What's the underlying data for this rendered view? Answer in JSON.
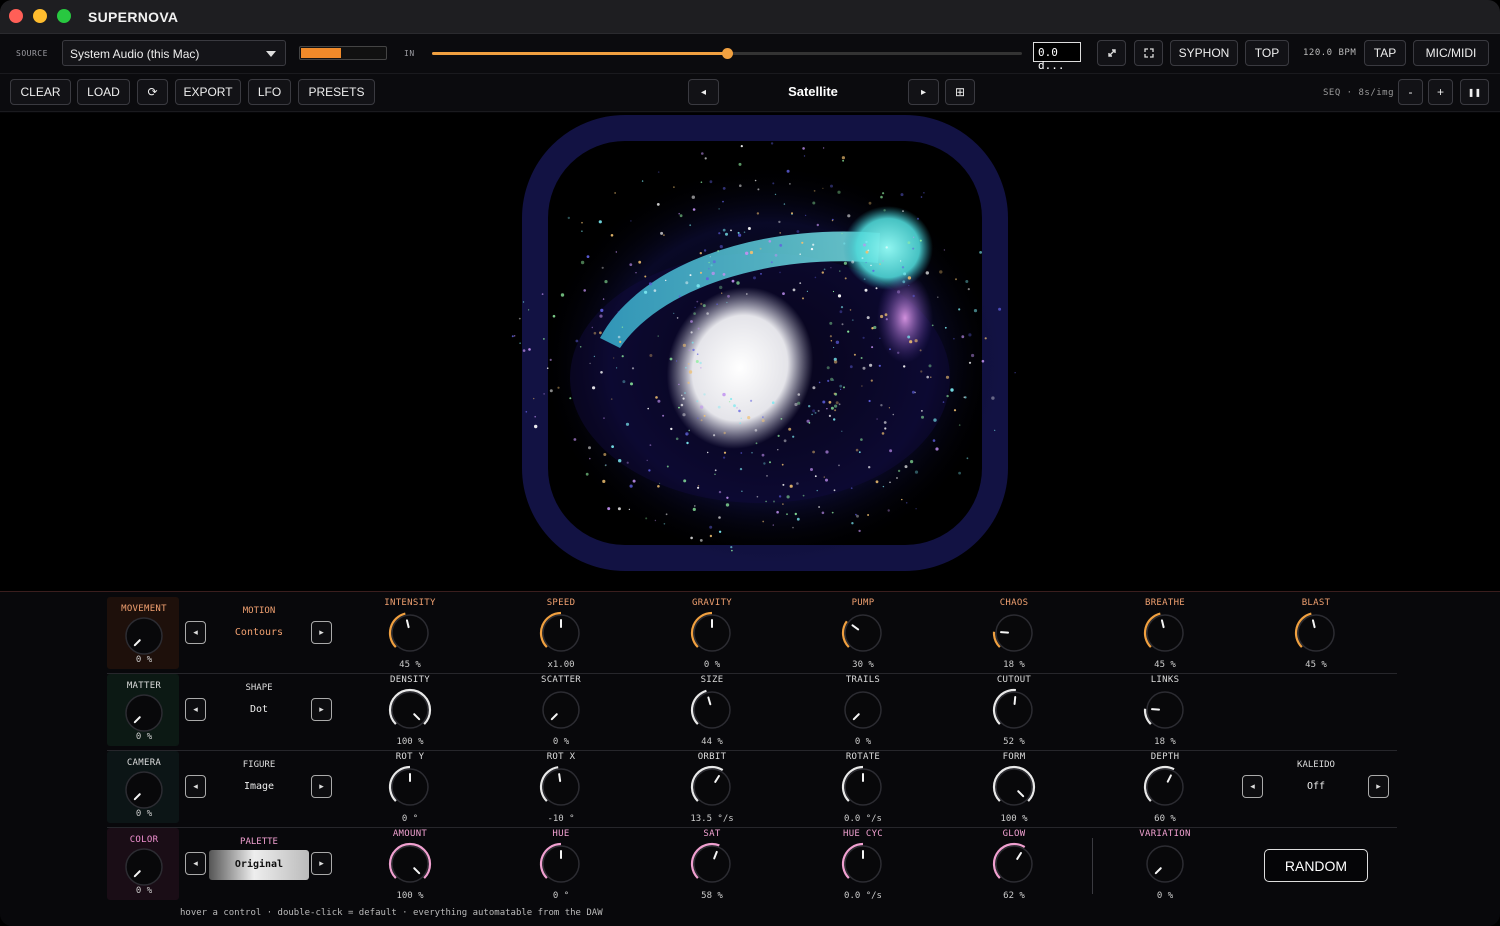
{
  "window": {
    "title": "SUPERNOVA"
  },
  "toolbar1": {
    "source_label": "SOURCE",
    "source_value": "System Audio (this Mac)",
    "level": 0.47,
    "in_label": "IN",
    "in_gain": 0.5,
    "readout": "0.0 d...",
    "minimize_icon": "diagonal-arrows-icon",
    "fullscreen_icon": "fullscreen-corners-icon",
    "syphon": "SYPHON",
    "top": "TOP",
    "bpm": "120.0 BPM",
    "tap": "TAP",
    "micmidi": "MIC/MIDI"
  },
  "toolbar2": {
    "clear": "CLEAR",
    "load": "LOAD",
    "refresh_glyph": "⟳",
    "export": "EXPORT",
    "lfo": "LFO",
    "presets": "PRESETS",
    "prev_glyph": "◂",
    "preset_name": "Satellite",
    "next_glyph": "▸",
    "grid_glyph": "⊞",
    "seq": "SEQ · 8s/img",
    "minus": "-",
    "plus": "+",
    "pause_glyph": "❚❚"
  },
  "sections": [
    {
      "name": "MOVEMENT",
      "value": "0 %",
      "color": "#f0a070",
      "bg": "#1e100b",
      "pos": 0.0
    },
    {
      "name": "MATTER",
      "value": "0 %",
      "color": "#dddddd",
      "bg": "#0c1914",
      "pos": 0.0
    },
    {
      "name": "CAMERA",
      "value": "0 %",
      "color": "#dddddd",
      "bg": "#0c1516",
      "pos": 0.0
    },
    {
      "name": "COLOR",
      "value": "0 %",
      "color": "#f090d0",
      "bg": "#1a0d16",
      "pos": 0.0
    }
  ],
  "choosers": [
    {
      "label": "MOTION",
      "value": "Contours",
      "color": "#f0a070"
    },
    {
      "label": "SHAPE",
      "value": "Dot",
      "color": "#dddddd"
    },
    {
      "label": "FIGURE",
      "value": "Image",
      "color": "#dddddd"
    },
    {
      "label": "PALETTE",
      "value": "Original",
      "color": "#f0a0d0"
    }
  ],
  "rows": [
    {
      "label_color": "#f0a070",
      "arc_color": "#f0a040",
      "knobs": [
        {
          "name": "INTENSITY",
          "value": "45 %",
          "pos": 0.45
        },
        {
          "name": "SPEED",
          "value": "x1.00",
          "pos": 0.5
        },
        {
          "name": "GRAVITY",
          "value": "0 %",
          "pos": 0.5
        },
        {
          "name": "PUMP",
          "value": "30 %",
          "pos": 0.3
        },
        {
          "name": "CHAOS",
          "value": "18 %",
          "pos": 0.18
        },
        {
          "name": "BREATHE",
          "value": "45 %",
          "pos": 0.45
        },
        {
          "name": "BLAST",
          "value": "45 %",
          "pos": 0.45
        }
      ]
    },
    {
      "label_color": "#dddddd",
      "arc_color": "#e8e8e8",
      "knobs": [
        {
          "name": "DENSITY",
          "value": "100 %",
          "pos": 1.0
        },
        {
          "name": "SCATTER",
          "value": "0 %",
          "pos": 0.0
        },
        {
          "name": "SIZE",
          "value": "44 %",
          "pos": 0.44
        },
        {
          "name": "TRAILS",
          "value": "0 %",
          "pos": 0.0
        },
        {
          "name": "CUTOUT",
          "value": "52 %",
          "pos": 0.52
        },
        {
          "name": "LINKS",
          "value": "18 %",
          "pos": 0.18
        }
      ]
    },
    {
      "label_color": "#dddddd",
      "arc_color": "#e8e8e8",
      "knobs": [
        {
          "name": "ROT Y",
          "value": "0 °",
          "pos": 0.5
        },
        {
          "name": "ROT X",
          "value": "-10 °",
          "pos": 0.47
        },
        {
          "name": "ORBIT",
          "value": "13.5 °/s",
          "pos": 0.62
        },
        {
          "name": "ROTATE",
          "value": "0.0 °/s",
          "pos": 0.5
        },
        {
          "name": "FORM",
          "value": "100 %",
          "pos": 1.0
        },
        {
          "name": "DEPTH",
          "value": "60 %",
          "pos": 0.6
        }
      ]
    },
    {
      "label_color": "#f0a0d0",
      "arc_color": "#f0a0d0",
      "knobs": [
        {
          "name": "AMOUNT",
          "value": "100 %",
          "pos": 1.0
        },
        {
          "name": "HUE",
          "value": "0 °",
          "pos": 0.5
        },
        {
          "name": "SAT",
          "value": "58 %",
          "pos": 0.58
        },
        {
          "name": "HUE CYC",
          "value": "0.0 °/s",
          "pos": 0.5
        },
        {
          "name": "GLOW",
          "value": "62 %",
          "pos": 0.62
        }
      ]
    }
  ],
  "kaleido": {
    "label": "KALEIDO",
    "value": "Off"
  },
  "variation": {
    "name": "VARIATION",
    "value": "0 %",
    "pos": 0.0
  },
  "random": "RANDOM",
  "footer": "hover a control · double-click = default · everything automatable from the DAW"
}
